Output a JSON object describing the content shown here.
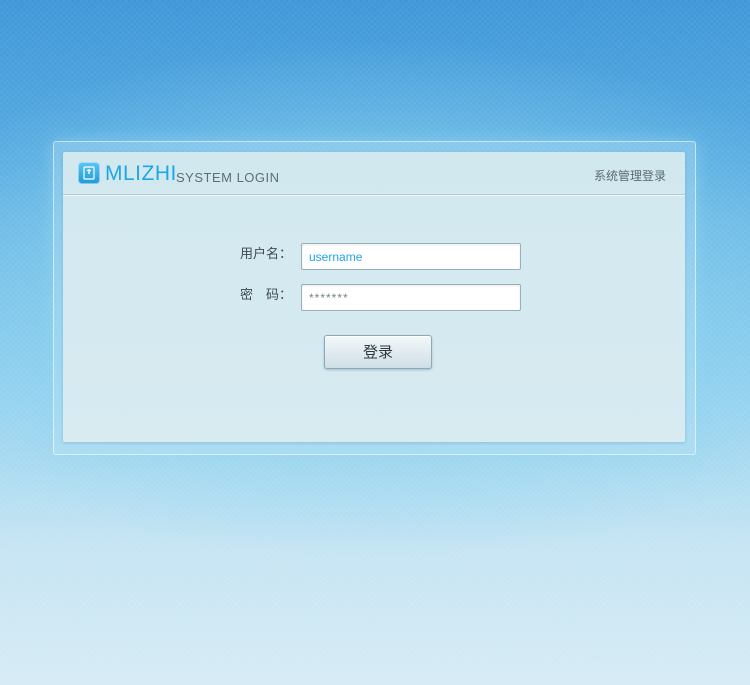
{
  "header": {
    "brand": "MLIZHI",
    "subtitle": "SYSTEM LOGIN",
    "right_text": "系统管理登录",
    "logo_icon": "book-icon"
  },
  "form": {
    "username_label": "用户名：",
    "username_value": "username",
    "password_label": "密　码：",
    "password_value": "*******",
    "login_button": "登录"
  },
  "colors": {
    "accent": "#1ea7e6",
    "panel_bg": "#d5eaf0",
    "background_top": "#3f97d8",
    "background_bottom": "#d6ebf5"
  }
}
